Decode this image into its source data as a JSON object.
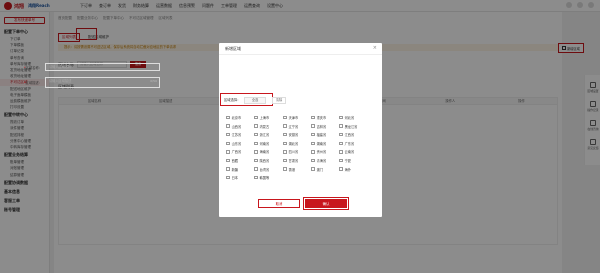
{
  "topbar": {
    "brand": "鸿翔",
    "brand_sub": "鸿翔Reach",
    "nav": [
      "下订单",
      "查订单",
      "发货",
      "财务结算",
      "运营数据",
      "信息预警",
      "问题件",
      "工单管理",
      "运费查询",
      "设置中心"
    ],
    "right": [
      "消息",
      "帮助",
      "用户"
    ]
  },
  "sidebar": {
    "action": "发布快递单号",
    "groups": [
      {
        "title": "配置下单中心",
        "items": [
          "下订单",
          "下单模板",
          "订单记录",
          "单号查询",
          "单号库存管理",
          "发货地址管理",
          "收货地址管理",
          "不可达区域",
          "配送地区维护",
          "电子面单模板",
          "运费模板维护",
          "打印设置"
        ]
      },
      {
        "title": "配置中转中心",
        "items": [
          "揽收订单",
          "派件管理",
          "配送排程",
          "分拣中心管理",
          "中转库存管理"
        ]
      },
      {
        "title": "配置业务结算",
        "items": [
          "账单管理",
          "对账管理",
          "结算管理"
        ]
      },
      {
        "title": "配置协调数据",
        "items": []
      },
      {
        "title": "基本信息",
        "items": []
      },
      {
        "title": "客服工单",
        "items": []
      },
      {
        "title": "账号管理",
        "items": []
      }
    ],
    "active_item": "不可达区域"
  },
  "main": {
    "breadcrumbs": [
      "首页配置",
      "配置业务中心",
      "配置下单中心",
      "不可达区域管理",
      "区域列表"
    ],
    "tabs": [
      "区域列表",
      "配送区域维护"
    ],
    "notice": "提示：请按需设置不可送达区域，保存后系统将自动拦截对应地区的下单请求",
    "filter_placeholder": "请输入区域名称",
    "filter_label": "区域名称",
    "search_btn": "搜索",
    "list_title": "区域列表",
    "table_headers": [
      "区域名称",
      "区域描述",
      "区域范围",
      "创建时间",
      "更新时间",
      "操作人",
      "操作"
    ],
    "add_btn": "新增区域"
  },
  "right_rail": [
    "区域设置",
    "操作记录",
    "在线咨询",
    "意见反馈"
  ],
  "modal": {
    "title": "新增区域",
    "name_label": "区域名称：",
    "name_placeholder": "请输入区域名称",
    "desc_label": "区域描述：",
    "desc_placeholder": "请输入区域描述",
    "desc_count": "0/50",
    "region_label": "区域选择：",
    "region_select": "全选",
    "region_clear": "清除",
    "provinces": [
      "北京市",
      "上海市",
      "天津市",
      "重庆市",
      "河北省",
      "山西省",
      "内蒙古",
      "辽宁省",
      "吉林省",
      "黑龙江省",
      "江苏省",
      "浙江省",
      "安徽省",
      "福建省",
      "江西省",
      "山东省",
      "河南省",
      "湖北省",
      "湖南省",
      "广东省",
      "广西省",
      "海南省",
      "四川省",
      "贵州省",
      "云南省",
      "西藏",
      "陕西省",
      "甘肃省",
      "青海省",
      "宁夏",
      "新疆",
      "台湾省",
      "香港",
      "澳门",
      "海外",
      "日本",
      "韩国等"
    ],
    "cancel": "取消",
    "confirm": "确认"
  }
}
